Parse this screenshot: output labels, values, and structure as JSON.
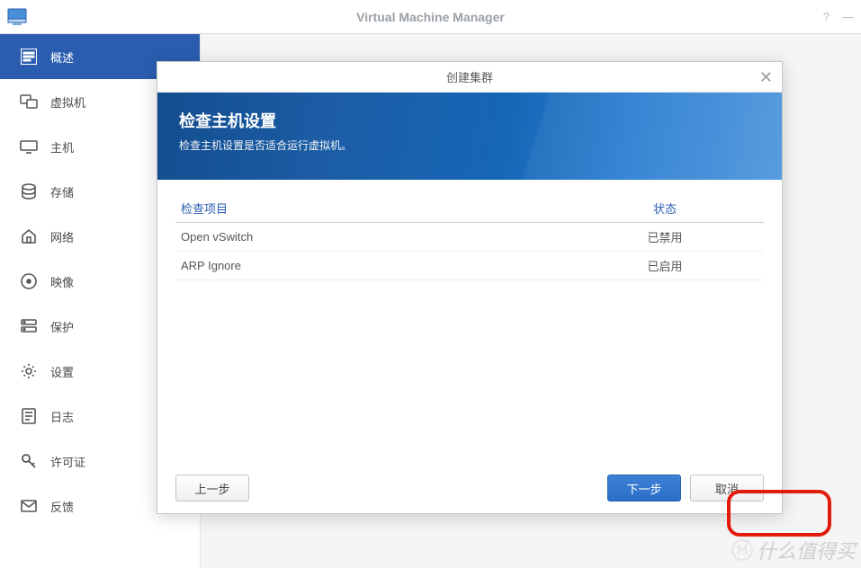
{
  "app": {
    "title": "Virtual Machine Manager"
  },
  "sidebar": {
    "items": [
      {
        "label": "概述"
      },
      {
        "label": "虚拟机"
      },
      {
        "label": "主机"
      },
      {
        "label": "存储"
      },
      {
        "label": "网络"
      },
      {
        "label": "映像"
      },
      {
        "label": "保护"
      },
      {
        "label": "设置"
      },
      {
        "label": "日志"
      },
      {
        "label": "许可证"
      },
      {
        "label": "反馈"
      }
    ]
  },
  "modal": {
    "title": "创建集群",
    "banner_heading": "检查主机设置",
    "banner_sub": "检查主机设置是否适合运行虚拟机。",
    "table": {
      "header_item": "检查项目",
      "header_status": "状态",
      "rows": [
        {
          "item": "Open vSwitch",
          "status": "已禁用"
        },
        {
          "item": "ARP Ignore",
          "status": "已启用"
        }
      ]
    },
    "buttons": {
      "prev": "上一步",
      "next": "下一步",
      "cancel": "取消"
    }
  },
  "watermark": {
    "text": "什么值得买"
  }
}
